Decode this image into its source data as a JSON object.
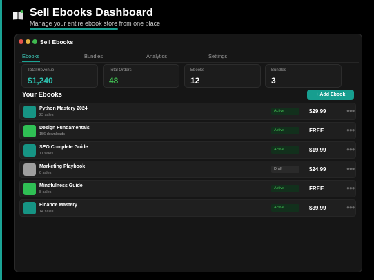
{
  "hero": {
    "title": "Sell Ebooks Dashboard",
    "subtitle": "Manage your entire ebook store from one place",
    "icon": "book-icon"
  },
  "window": {
    "title": "Sell Ebooks"
  },
  "tabs": [
    {
      "label": "Ebooks",
      "active": true
    },
    {
      "label": "Bundles",
      "active": false
    },
    {
      "label": "Analytics",
      "active": false
    },
    {
      "label": "Settings",
      "active": false
    }
  ],
  "stats": [
    {
      "label": "Total Revenue",
      "value": "$1,240"
    },
    {
      "label": "Total Orders",
      "value": "48"
    },
    {
      "label": "Ebooks",
      "value": "12"
    },
    {
      "label": "Bundles",
      "value": "3"
    }
  ],
  "section": {
    "title": "Your Ebooks",
    "add_label": "+ Add Ebook"
  },
  "ebooks": [
    {
      "title": "Python Mastery 2024",
      "meta": "23 sales",
      "status": "Active",
      "price": "$29.99",
      "thumb_color": "#169484"
    },
    {
      "title": "Design Fundamentals",
      "meta": "156 downloads",
      "status": "Active",
      "price": "FREE",
      "thumb_color": "#2fbf54"
    },
    {
      "title": "SEO Complete Guide",
      "meta": "11 sales",
      "status": "Active",
      "price": "$19.99",
      "thumb_color": "#169484"
    },
    {
      "title": "Marketing Playbook",
      "meta": "0 sales",
      "status": "Draft",
      "price": "$24.99",
      "thumb_color": "#9e9e9e"
    },
    {
      "title": "Mindfulness Guide",
      "meta": "8 sales",
      "status": "Active",
      "price": "FREE",
      "thumb_color": "#2fbf54"
    },
    {
      "title": "Finance Mastery",
      "meta": "14 sales",
      "status": "Active",
      "price": "$39.99",
      "thumb_color": "#169484"
    }
  ],
  "colors": {
    "accent": "#1aa394",
    "active_status": "#3fb950",
    "background": "#000000",
    "panel": "#161616"
  }
}
